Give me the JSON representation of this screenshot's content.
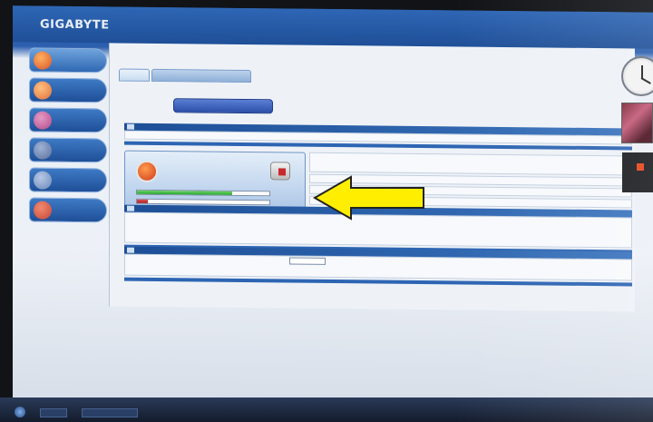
{
  "app": {
    "brand": "GIGABYTE"
  },
  "sidebar": {
    "items": [
      {
        "label": "",
        "icon": "fire-icon",
        "color": "#d8542a"
      },
      {
        "label": "",
        "icon": "globe-icon",
        "color": "#e0703a"
      },
      {
        "label": "",
        "icon": "wrench-icon",
        "color": "#b24a8a"
      },
      {
        "label": "",
        "icon": "gear-icon",
        "color": "#5a6f9a"
      },
      {
        "label": "",
        "icon": "chip-icon",
        "color": "#6b88b8"
      },
      {
        "label": "",
        "icon": "user-icon",
        "color": "#c54636"
      }
    ]
  },
  "main": {
    "breadcrumbs": "",
    "tabs": [
      {
        "label": ""
      },
      {
        "label": ""
      }
    ],
    "status_button": "",
    "sections": [
      {
        "title": "",
        "body": ""
      },
      {
        "title": "",
        "body": ""
      },
      {
        "title": "",
        "body": ""
      }
    ],
    "energy": {
      "label": "",
      "value": "",
      "green_level": 0.72,
      "red_level": 0.08,
      "description": ""
    },
    "audio_dropdown": ""
  },
  "taskbar": {
    "items": [
      "",
      ""
    ]
  },
  "colors": {
    "arrow": "#ffee00",
    "accent": "#2d65b3",
    "green": "#28a830",
    "red": "#c8282e"
  }
}
